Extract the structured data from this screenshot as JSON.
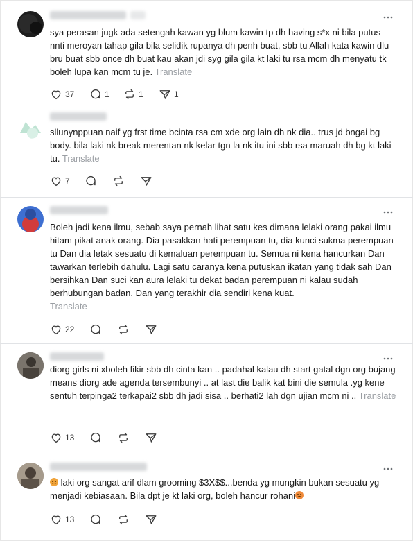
{
  "posts": [
    {
      "text": "sya perasan jugk ada setengah kawan yg blum kawin tp dh having s*x ni bila putus nnti meroyan tahap gila bila selidik rupanya dh penh buat, sbb tu Allah kata kawin dlu bru buat sbb once dh buat kau akan jdi syg gila gila kt laki tu rsa mcm dh menyatu tk boleh lupa kan mcm tu je.",
      "translate": "Translate",
      "likes": "37",
      "replies": "1",
      "reposts": "1",
      "shares": "1"
    },
    {
      "text": "sllunynppuan naif yg frst time bcinta rsa cm xde org lain dh nk dia.. trus jd bngai bg body. bila laki nk break merentan nk kelar tgn la nk itu ini sbb rsa maruah dh bg kt laki tu.",
      "translate": "Translate",
      "likes": "7"
    },
    {
      "text": "Boleh jadi kena ilmu, sebab saya pernah lihat satu kes dimana lelaki orang pakai ilmu hitam pikat anak orang. Dia pasakkan hati perempuan tu, dia kunci sukma perempuan tu Dan dia letak sesuatu di kemaluan perempuan tu. Semua ni kena hancurkan Dan tawarkan terlebih dahulu. Lagi satu caranya kena putuskan ikatan yang tidak sah Dan bersihkan Dan suci kan aura lelaki tu dekat badan perempuan ni kalau sudah berhubungan badan. Dan yang terakhir dia sendiri kena kuat.",
      "translate": "Translate",
      "likes": "22"
    },
    {
      "text": "diorg girls ni xboleh fikir sbb dh cinta kan .. padahal kalau dh start gatal dgn org bujang means diorg ade agenda tersembunyi .. at last die balik kat bini die semula .yg kene sentuh terpinga2 terkapai2 sbb dh jadi sisa .. berhati2 lah dgn ujian mcm ni ..",
      "translate": "Translate",
      "likes": "13"
    },
    {
      "text_pre": "laki org sangat arif dlam grooming $3X$$...benda yg mungkin bukan sesuatu yg menjadi kebiasaan. Bila dpt je kt laki org, boleh hancur rohani",
      "likes": "13",
      "emoji_1": "flushed-face-emoji",
      "emoji_2": "angry-face-emoji"
    }
  ],
  "colors": {
    "text": "#1a1a1a",
    "translate": "#9a9ea3",
    "divider": "#e1e3e6",
    "icon": "#3a3a3a"
  }
}
